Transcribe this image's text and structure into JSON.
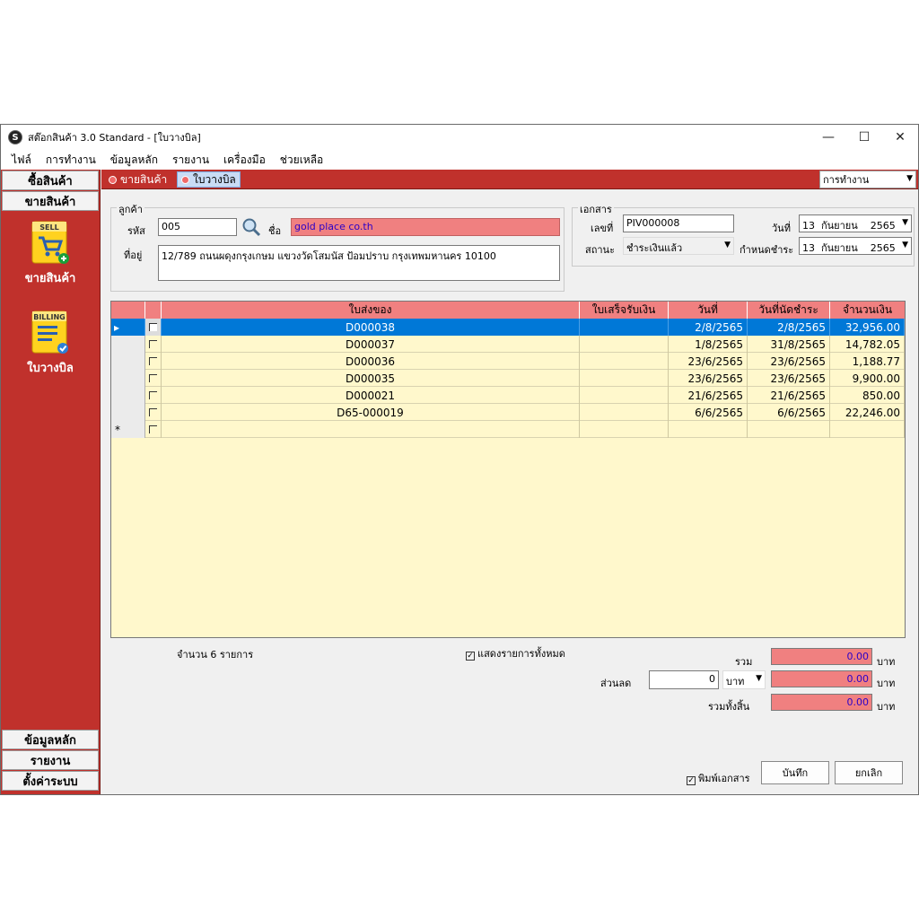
{
  "window": {
    "title": "สต๊อกสินค้า 3.0 Standard - [ใบวางบิล]",
    "app_icon": "S"
  },
  "menu": [
    "ไฟล์",
    "การทำงาน",
    "ข้อมูลหลัก",
    "รายงาน",
    "เครื่องมือ",
    "ช่วยเหลือ"
  ],
  "sidebar": {
    "top_buttons": [
      "ซื้อสินค้า",
      "ขายสินค้า"
    ],
    "tiles": [
      {
        "badge": "SELL",
        "label": "ขายสินค้า"
      },
      {
        "badge": "BILLING",
        "label": "ใบวางบิล"
      }
    ],
    "bottom_buttons": [
      "ข้อมูลหลัก",
      "รายงาน",
      "ตั้งค่าระบบ"
    ]
  },
  "tabs": [
    "ขายสินค้า",
    "ใบวางบิล"
  ],
  "operations_dropdown": "การทำงาน",
  "customer": {
    "group_title": "ลูกค้า",
    "code_label": "รหัส",
    "code_value": "005",
    "name_label": "ชื่อ",
    "name_value": "gold place  co.th",
    "address_label": "ที่อยู่",
    "address_value": "12/789  ถนนผดุงกรุงเกษม  แขวงวัดโสมนัส  ป้อมปราบ กรุงเทพมหานคร 10100"
  },
  "document": {
    "group_title": "เอกสาร",
    "number_label": "เลขที่",
    "number_value": "PIV000008",
    "date_label": "วันที่",
    "date_day": "13",
    "date_month": "กันยายน",
    "date_year": "2565",
    "status_label": "สถานะ",
    "status_value": "ชำระเงินแล้ว",
    "due_label": "กำหนดชำระ",
    "due_day": "13",
    "due_month": "กันยายน",
    "due_year": "2565"
  },
  "grid": {
    "columns": [
      "ใบส่งของ",
      "ใบเสร็จรับเงิน",
      "วันที่",
      "วันที่นัดชำระ",
      "จำนวนเงิน"
    ],
    "rows": [
      {
        "delivery": "D000038",
        "receipt": "",
        "date": "2/8/2565",
        "due": "2/8/2565",
        "amount": "32,956.00"
      },
      {
        "delivery": "D000037",
        "receipt": "",
        "date": "1/8/2565",
        "due": "31/8/2565",
        "amount": "14,782.05"
      },
      {
        "delivery": "D000036",
        "receipt": "",
        "date": "23/6/2565",
        "due": "23/6/2565",
        "amount": "1,188.77"
      },
      {
        "delivery": "D000035",
        "receipt": "",
        "date": "23/6/2565",
        "due": "23/6/2565",
        "amount": "9,900.00"
      },
      {
        "delivery": "D000021",
        "receipt": "",
        "date": "21/6/2565",
        "due": "21/6/2565",
        "amount": "850.00"
      },
      {
        "delivery": "D65-000019",
        "receipt": "",
        "date": "6/6/2565",
        "due": "6/6/2565",
        "amount": "22,246.00"
      }
    ],
    "new_row_marker": "*",
    "selected_marker": "▸"
  },
  "footer": {
    "count_text": "จำนวน 6 รายการ",
    "show_all_label": "แสดงรายการทั้งหมด",
    "total_label": "รวม",
    "total_value": "0.00",
    "discount_label": "ส่วนลด",
    "discount_value": "0",
    "discount_unit": "บาท",
    "discount_value_amount": "0.00",
    "grand_total_label": "รวมทั้งสิ้น",
    "grand_total_value": "0.00",
    "currency": "บาท",
    "print_label": "พิมพ์เอกสาร",
    "save_label": "บันทึก",
    "cancel_label": "ยกเลิก"
  },
  "colors": {
    "sidebar": "#c0312c",
    "grid_header": "#f08080",
    "grid_body": "#fff8cc",
    "selection": "#0078d7"
  }
}
